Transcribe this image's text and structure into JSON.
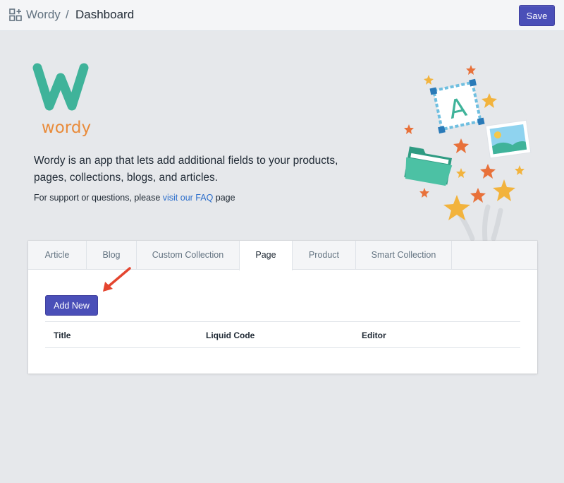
{
  "topbar": {
    "app_name": "Wordy",
    "separator": "/",
    "page_name": "Dashboard",
    "save_label": "Save"
  },
  "hero": {
    "logo_letter": "W",
    "logo_word": "wordy",
    "intro_line1": "Wordy is an app that lets add additional fields to your products,",
    "intro_line2": "pages, collections, blogs, and articles.",
    "support_prefix": "For support or questions, please ",
    "support_link": "visit our FAQ",
    "support_suffix": " page",
    "illustration_letter": "A"
  },
  "tabs": [
    {
      "label": "Article",
      "active": false
    },
    {
      "label": "Blog",
      "active": false
    },
    {
      "label": "Custom Collection",
      "active": false
    },
    {
      "label": "Page",
      "active": true
    },
    {
      "label": "Product",
      "active": false
    },
    {
      "label": "Smart Collection",
      "active": false
    }
  ],
  "panel": {
    "add_label": "Add New",
    "columns": [
      "Title",
      "Liquid Code",
      "Editor"
    ]
  },
  "colors": {
    "brand_teal": "#3fb39a",
    "brand_orange": "#e98b3a",
    "button": "#4a4fb8",
    "link": "#2c6ecb",
    "arrow": "#e4452f"
  }
}
